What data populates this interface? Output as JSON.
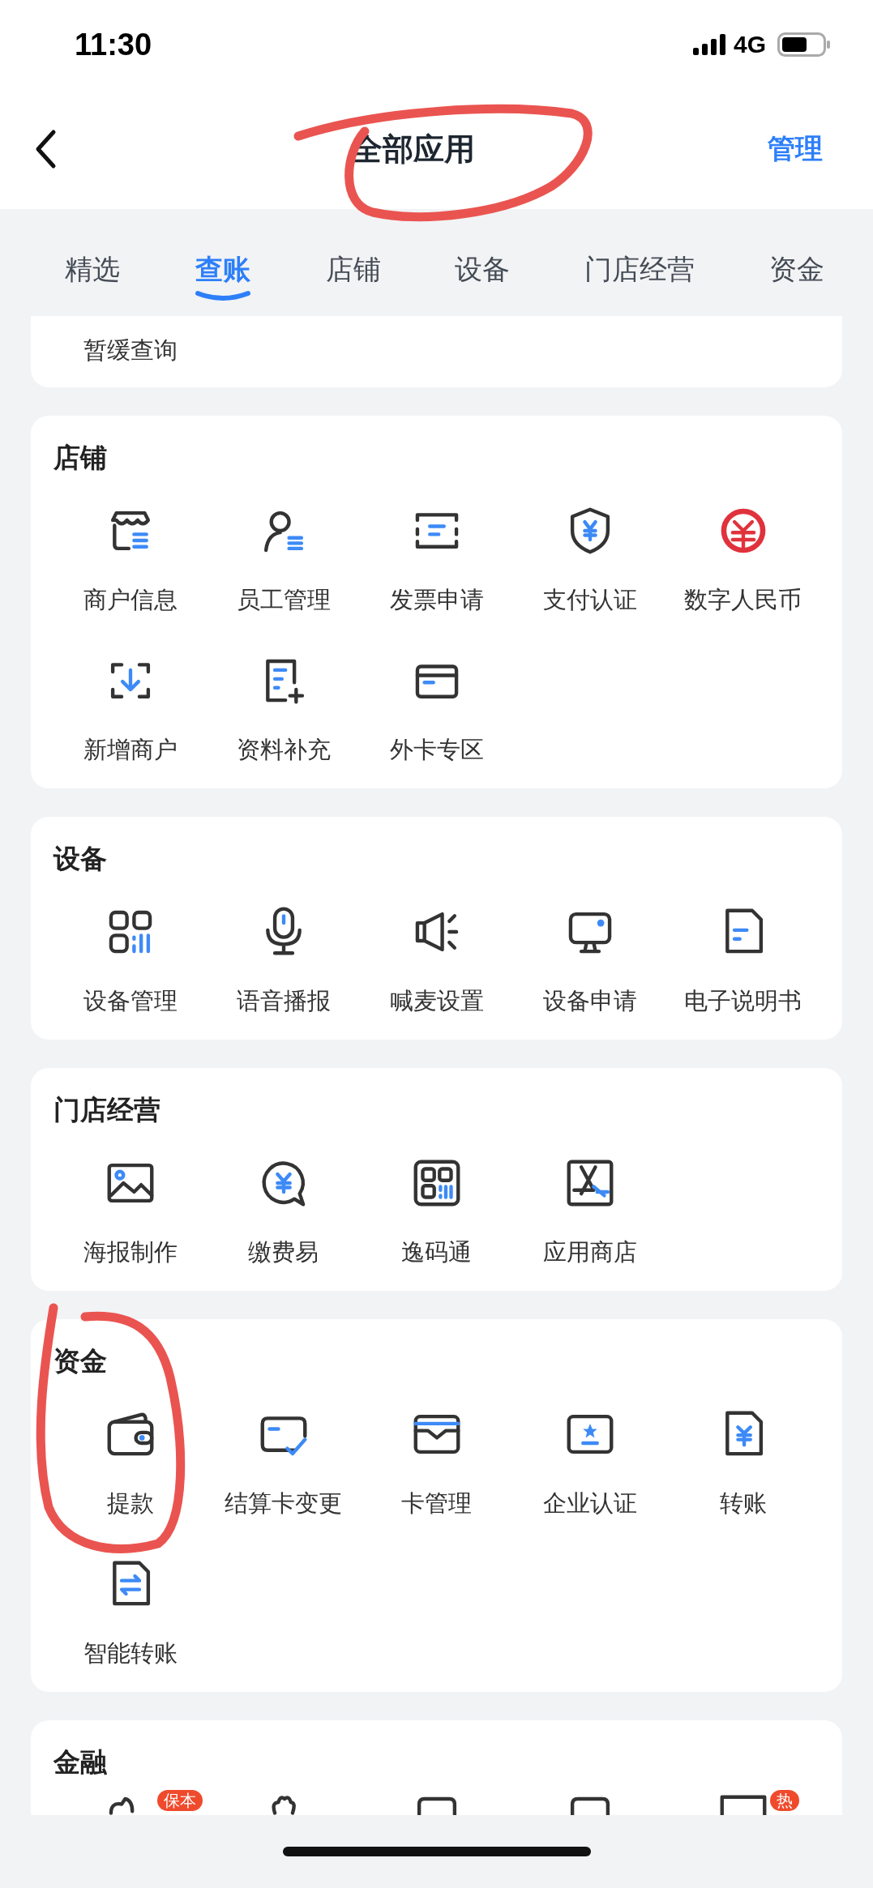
{
  "status_bar": {
    "time": "11:30",
    "network": "4G"
  },
  "nav_bar": {
    "title": "全部应用",
    "action": "管理"
  },
  "tabs": [
    {
      "label": "精选",
      "selected": false
    },
    {
      "label": "查账",
      "selected": true
    },
    {
      "label": "店铺",
      "selected": false
    },
    {
      "label": "设备",
      "selected": false
    },
    {
      "label": "门店经营",
      "selected": false
    },
    {
      "label": "资金",
      "selected": false
    }
  ],
  "sections": [
    {
      "kind": "partial",
      "items": [
        {
          "kind": "app",
          "label": "暂缓查询"
        }
      ]
    },
    {
      "kind": "full",
      "title": "店铺",
      "items": [
        {
          "kind": "app",
          "label": "商户信息"
        },
        {
          "kind": "app",
          "label": "员工管理"
        },
        {
          "kind": "app",
          "label": "发票申请"
        },
        {
          "kind": "app",
          "label": "支付认证"
        },
        {
          "kind": "app",
          "label": "数字人民币"
        },
        {
          "kind": "app",
          "label": "新增商户"
        },
        {
          "kind": "app",
          "label": "资料补充"
        },
        {
          "kind": "app",
          "label": "外卡专区"
        }
      ]
    },
    {
      "kind": "full",
      "title": "设备",
      "items": [
        {
          "kind": "app",
          "label": "设备管理"
        },
        {
          "kind": "app",
          "label": "语音播报"
        },
        {
          "kind": "app",
          "label": "喊麦设置"
        },
        {
          "kind": "app",
          "label": "设备申请"
        },
        {
          "kind": "app",
          "label": "电子说明书"
        }
      ]
    },
    {
      "kind": "full",
      "title": "门店经营",
      "items": [
        {
          "kind": "app",
          "label": "海报制作"
        },
        {
          "kind": "app",
          "label": "缴费易"
        },
        {
          "kind": "app",
          "label": "逸码通"
        },
        {
          "kind": "app",
          "label": "应用商店"
        }
      ]
    },
    {
      "kind": "full",
      "title": "资金",
      "items": [
        {
          "kind": "app",
          "label": "提款"
        },
        {
          "kind": "app",
          "label": "结算卡变更"
        },
        {
          "kind": "app",
          "label": "卡管理"
        },
        {
          "kind": "app",
          "label": "企业认证"
        },
        {
          "kind": "app",
          "label": "转账"
        },
        {
          "kind": "app",
          "label": "智能转账"
        }
      ]
    },
    {
      "kind": "clipped",
      "title": "金融",
      "items": [
        {
          "kind": "app",
          "badge": "保本"
        },
        {
          "kind": "app"
        },
        {
          "kind": "app"
        },
        {
          "kind": "app"
        },
        {
          "kind": "app",
          "badge": "热"
        }
      ]
    }
  ]
}
